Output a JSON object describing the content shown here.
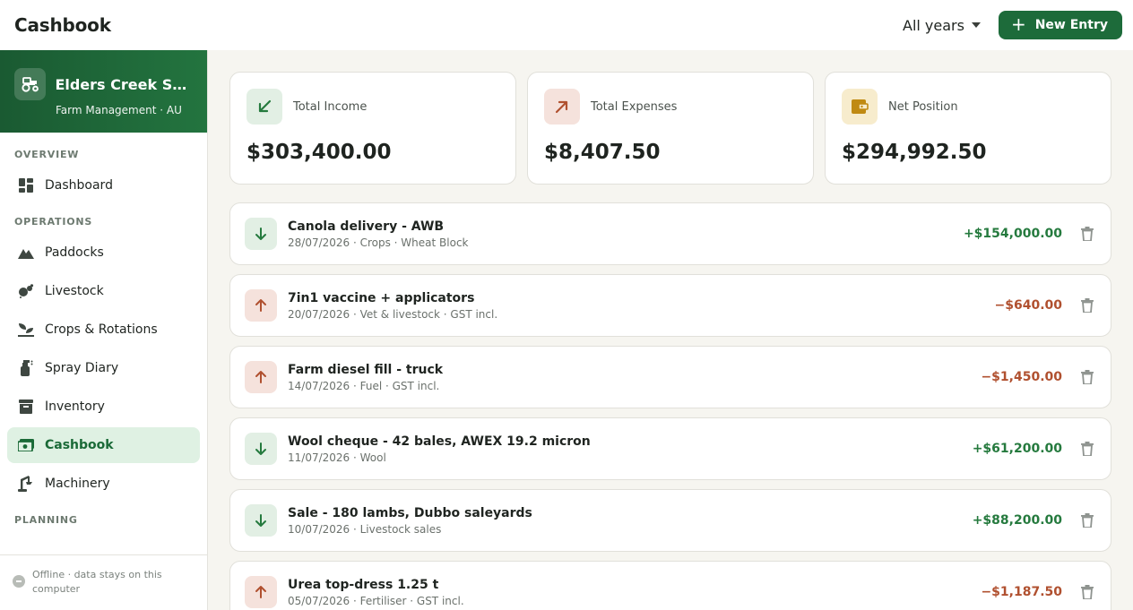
{
  "header": {
    "title": "Cashbook",
    "year_filter": "All years",
    "new_entry_label": "New Entry"
  },
  "farm": {
    "name": "Elders Creek Stati...",
    "subtitle": "Farm Management · AU"
  },
  "nav": {
    "sections": [
      {
        "title": "OVERVIEW",
        "items": [
          {
            "label": "Dashboard",
            "icon": "dashboard-icon"
          }
        ]
      },
      {
        "title": "OPERATIONS",
        "items": [
          {
            "label": "Paddocks",
            "icon": "mountain-icon"
          },
          {
            "label": "Livestock",
            "icon": "livestock-icon"
          },
          {
            "label": "Crops & Rotations",
            "icon": "sprout-icon"
          },
          {
            "label": "Spray Diary",
            "icon": "spray-bottle-icon"
          },
          {
            "label": "Inventory",
            "icon": "archive-box-icon"
          },
          {
            "label": "Cashbook",
            "icon": "cash-icon",
            "active": true
          },
          {
            "label": "Machinery",
            "icon": "tractor-arm-icon"
          }
        ]
      },
      {
        "title": "PLANNING",
        "items": []
      }
    ],
    "footer": "Offline · data stays on this computer"
  },
  "summary": {
    "income": {
      "label": "Total Income",
      "value": "$303,400.00",
      "icon": "arrow-down-left-icon"
    },
    "expenses": {
      "label": "Total Expenses",
      "value": "$8,407.50",
      "icon": "arrow-up-right-icon"
    },
    "net": {
      "label": "Net Position",
      "value": "$294,992.50",
      "icon": "wallet-icon"
    }
  },
  "entries": [
    {
      "title": "Canola delivery - AWB",
      "meta": "28/07/2026 · Crops · Wheat Block",
      "amount": "+$154,000.00",
      "direction": "in"
    },
    {
      "title": "7in1 vaccine + applicators",
      "meta": "20/07/2026 · Vet & livestock · GST incl.",
      "amount": "−$640.00",
      "direction": "out"
    },
    {
      "title": "Farm diesel fill - truck",
      "meta": "14/07/2026 · Fuel · GST incl.",
      "amount": "−$1,450.00",
      "direction": "out"
    },
    {
      "title": "Wool cheque - 42 bales, AWEX 19.2 micron",
      "meta": "11/07/2026 · Wool",
      "amount": "+$61,200.00",
      "direction": "in"
    },
    {
      "title": "Sale - 180 lambs, Dubbo saleyards",
      "meta": "10/07/2026 · Livestock sales",
      "amount": "+$88,200.00",
      "direction": "in"
    },
    {
      "title": "Urea top-dress 1.25 t",
      "meta": "05/07/2026 · Fertiliser · GST incl.",
      "amount": "−$1,187.50",
      "direction": "out"
    }
  ],
  "colors": {
    "brand": "#1d6b3a",
    "income": "#257a3e",
    "expense": "#b0502f",
    "net": "#c08a12"
  }
}
